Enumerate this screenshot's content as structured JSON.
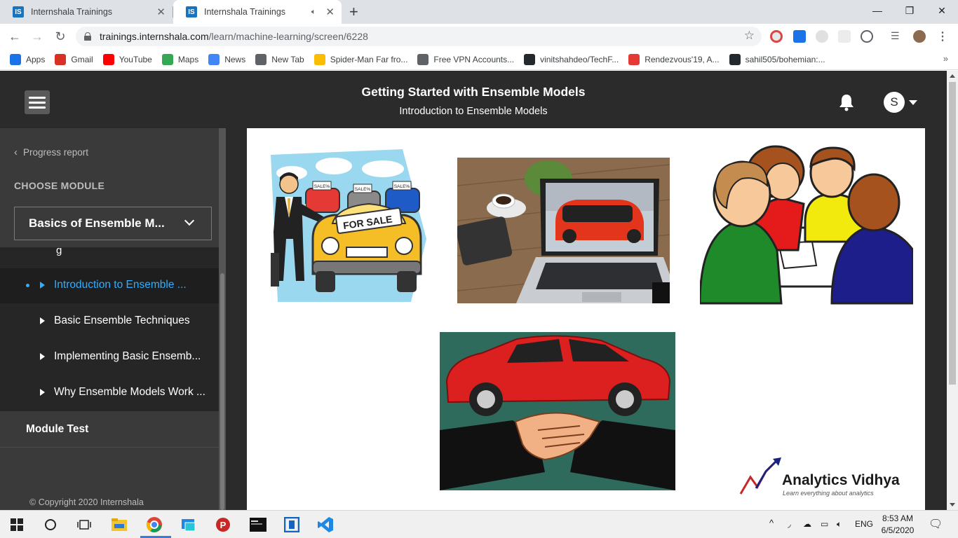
{
  "browser": {
    "tabs": [
      {
        "label": "Internshala Trainings",
        "favicon": "IS",
        "active": false
      },
      {
        "label": "Internshala Trainings",
        "favicon": "IS",
        "active": true
      }
    ],
    "url_host": "trainings.internshala.com",
    "url_path": "/learn/machine-learning/screen/6228",
    "bookmarks": [
      {
        "label": "Apps",
        "icon": "apps-grid-icon",
        "color": "#1a73e8"
      },
      {
        "label": "Gmail",
        "icon": "gmail-icon",
        "color": "#d93025"
      },
      {
        "label": "YouTube",
        "icon": "youtube-icon",
        "color": "#ff0000"
      },
      {
        "label": "Maps",
        "icon": "maps-pin-icon",
        "color": "#34a853"
      },
      {
        "label": "News",
        "icon": "news-icon",
        "color": "#4285f4"
      },
      {
        "label": "New Tab",
        "icon": "globe-icon",
        "color": "#5f6368"
      },
      {
        "label": "Spider-Man Far fro...",
        "icon": "drive-icon",
        "color": "#fbbc04"
      },
      {
        "label": "Free VPN Accounts...",
        "icon": "globe-icon",
        "color": "#5f6368"
      },
      {
        "label": "vinitshahdeo/TechF...",
        "icon": "github-icon",
        "color": "#24292e"
      },
      {
        "label": "Rendezvous'19, A...",
        "icon": "rendezvous-icon",
        "color": "#e53935"
      },
      {
        "label": "sahil505/bohemian:...",
        "icon": "github-icon",
        "color": "#24292e"
      }
    ]
  },
  "header": {
    "course_title": "Getting Started with Ensemble Models",
    "lesson_title": "Introduction to Ensemble Models",
    "avatar_letter": "S"
  },
  "sidebar": {
    "progress_label": "Progress report",
    "choose_label": "CHOOSE MODULE",
    "selected_module": "Basics of Ensemble M...",
    "truncated_item": "g",
    "items": [
      {
        "label": "Introduction to Ensemble ...",
        "active": true
      },
      {
        "label": "Basic Ensemble Techniques",
        "active": false
      },
      {
        "label": "Implementing Basic Ensemb...",
        "active": false
      },
      {
        "label": "Why Ensemble Models Work ...",
        "active": false
      }
    ],
    "module_test": "Module Test",
    "copyright": "Copyright 2020 Internshala"
  },
  "slide": {
    "for_sale_text": "FOR SALE",
    "sale_tag": "SALE%",
    "logo_name": "Analytics Vidhya",
    "logo_tagline": "Learn everything about analytics"
  },
  "taskbar": {
    "language": "ENG",
    "time": "8:53 AM",
    "date": "6/5/2020"
  },
  "colors": {
    "header_bg": "#2b2b2b",
    "sidebar_bg": "#3a3a3a",
    "active_item": "#33adff"
  }
}
